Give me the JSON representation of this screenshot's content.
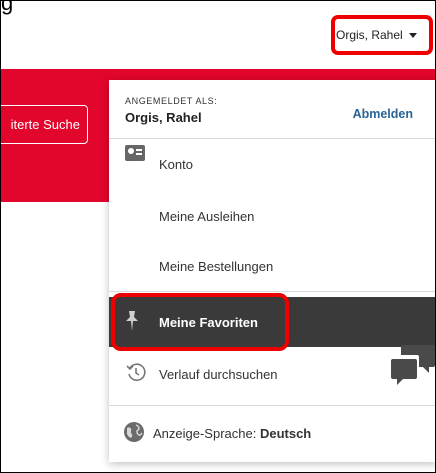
{
  "cut_top_text": "g",
  "header": {
    "user_button_label": "Orgis, Rahel"
  },
  "search": {
    "button_label": "iterte Suche"
  },
  "dropdown": {
    "logged_in_as_label": "ANGEMELDET ALS:",
    "username": "Orgis, Rahel",
    "logout_label": "Abmelden",
    "items": [
      {
        "label": "Konto",
        "icon": "account-card-icon"
      },
      {
        "label": "Meine Ausleihen"
      },
      {
        "label": "Meine Bestellungen"
      },
      {
        "label": "Meine Favoriten",
        "icon": "pin-icon",
        "active": true
      },
      {
        "label": "Verlauf durchsuchen",
        "icon": "history-icon"
      }
    ],
    "language": {
      "prefix": "Anzeige-Sprache: ",
      "value": "Deutsch",
      "icon": "globe-icon"
    }
  },
  "colors": {
    "brand_red": "#e2062c",
    "active_bg": "#3a3a3a",
    "link_blue": "#2a6496",
    "annotation_red": "#ee0000"
  },
  "floating": {
    "chat_icon": "chat-bubbles-icon"
  }
}
